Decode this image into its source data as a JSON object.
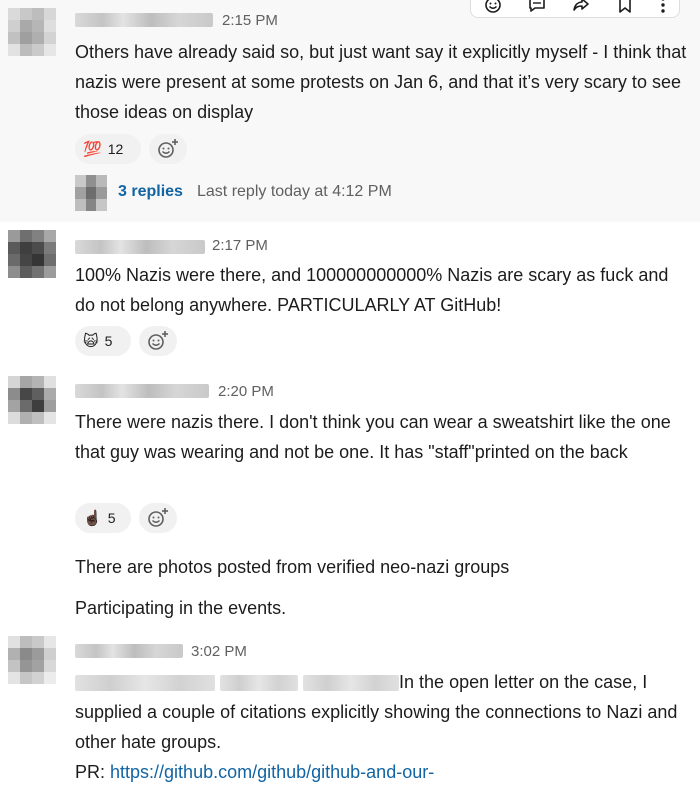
{
  "toolbar": {
    "icons": [
      "emoji-icon",
      "reply-in-thread-icon",
      "share-icon",
      "bookmark-icon",
      "more-actions-icon"
    ]
  },
  "messages": [
    {
      "time": "2:15 PM",
      "text": "Others have already said so, but just want say it explicitly myself - I think that nazis were present at some protests on Jan 6, and that it’s very scary to see those ideas on display",
      "reactions": [
        {
          "emoji": "💯",
          "count": "12"
        }
      ],
      "thread": {
        "replies": "3 replies",
        "last_reply": "Last reply today at 4:12 PM"
      }
    },
    {
      "time": "2:17 PM",
      "text": "100% Nazis were there, and 100000000000% Nazis are scary as fuck and do not belong anywhere. PARTICULARLY AT GitHub!",
      "reactions": [
        {
          "emoji": "🙀",
          "count": "5"
        }
      ]
    },
    {
      "time": "2:20 PM",
      "text": "There were nazis there.  I don't think you can wear a sweatshirt like the one that guy was wearing and not be one.  It has \"staff\"printed on the back",
      "reactions": [
        {
          "emoji": "☝🏿",
          "count": "5"
        }
      ],
      "followups": [
        "There are photos posted from verified neo-nazi groups",
        "Participating in the events."
      ]
    },
    {
      "time": "3:02 PM",
      "text_part1": "In the open letter on the case,",
      "text_part2": "I supplied a couple of citations explicitly showing the connections to Nazi and other hate groups.",
      "pr_label": "PR: ",
      "pr_link": "https://github.com/github/github-and-our-"
    }
  ]
}
